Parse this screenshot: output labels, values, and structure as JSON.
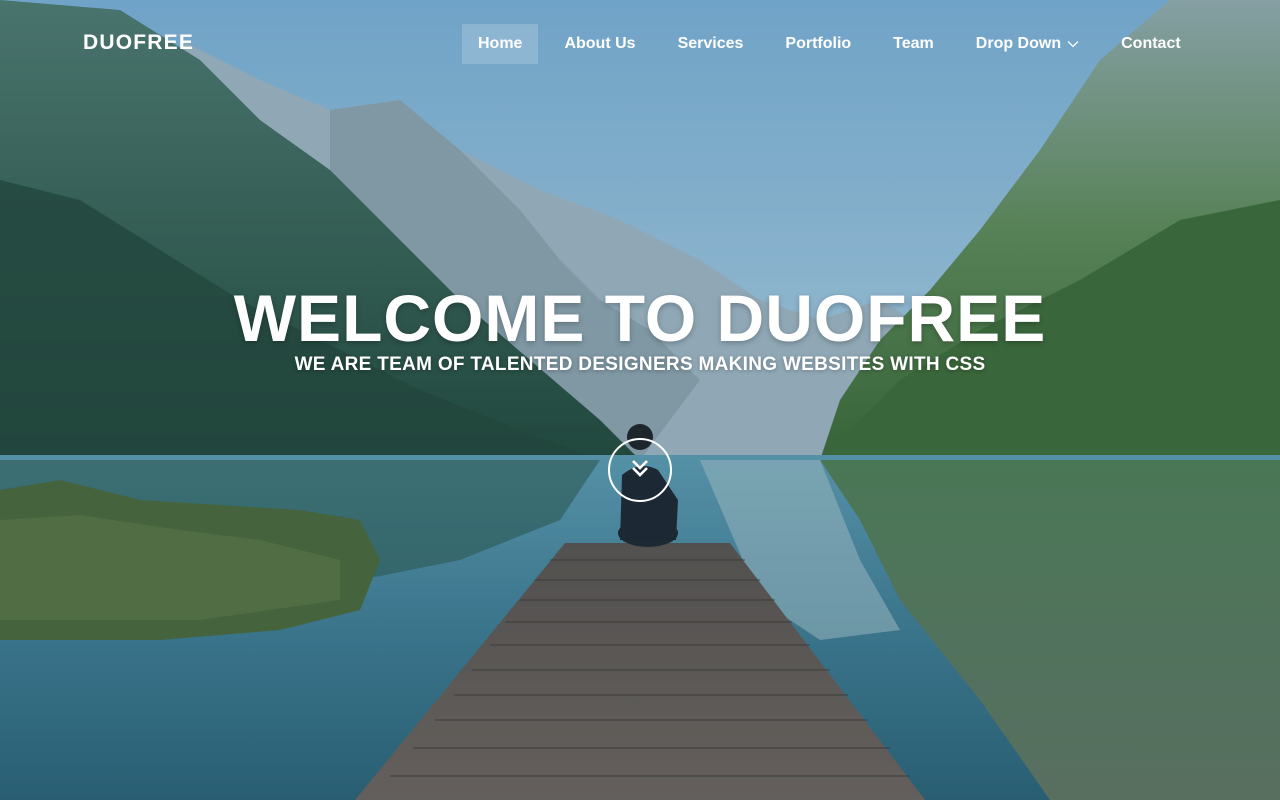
{
  "brand": {
    "logo_text": "DUOFREE"
  },
  "nav": {
    "items": [
      {
        "label": "Home",
        "active": true
      },
      {
        "label": "About Us"
      },
      {
        "label": "Services"
      },
      {
        "label": "Portfolio"
      },
      {
        "label": "Team"
      },
      {
        "label": "Drop Down",
        "icon": "chevron-down-icon"
      },
      {
        "label": "Contact"
      }
    ]
  },
  "hero": {
    "title": "WELCOME TO DUOFREE",
    "subtitle": "WE ARE TEAM OF TALENTED DESIGNERS MAKING WEBSITES WITH CSS",
    "scroll_icon": "double-chevron-down-icon",
    "background": "mountain-lake-pier-photo"
  },
  "colors": {
    "text": "#ffffff",
    "active_nav_bg": "rgba(255,255,255,0.18)",
    "sky": "#7fb4d6",
    "water": "#4e8fa6"
  }
}
